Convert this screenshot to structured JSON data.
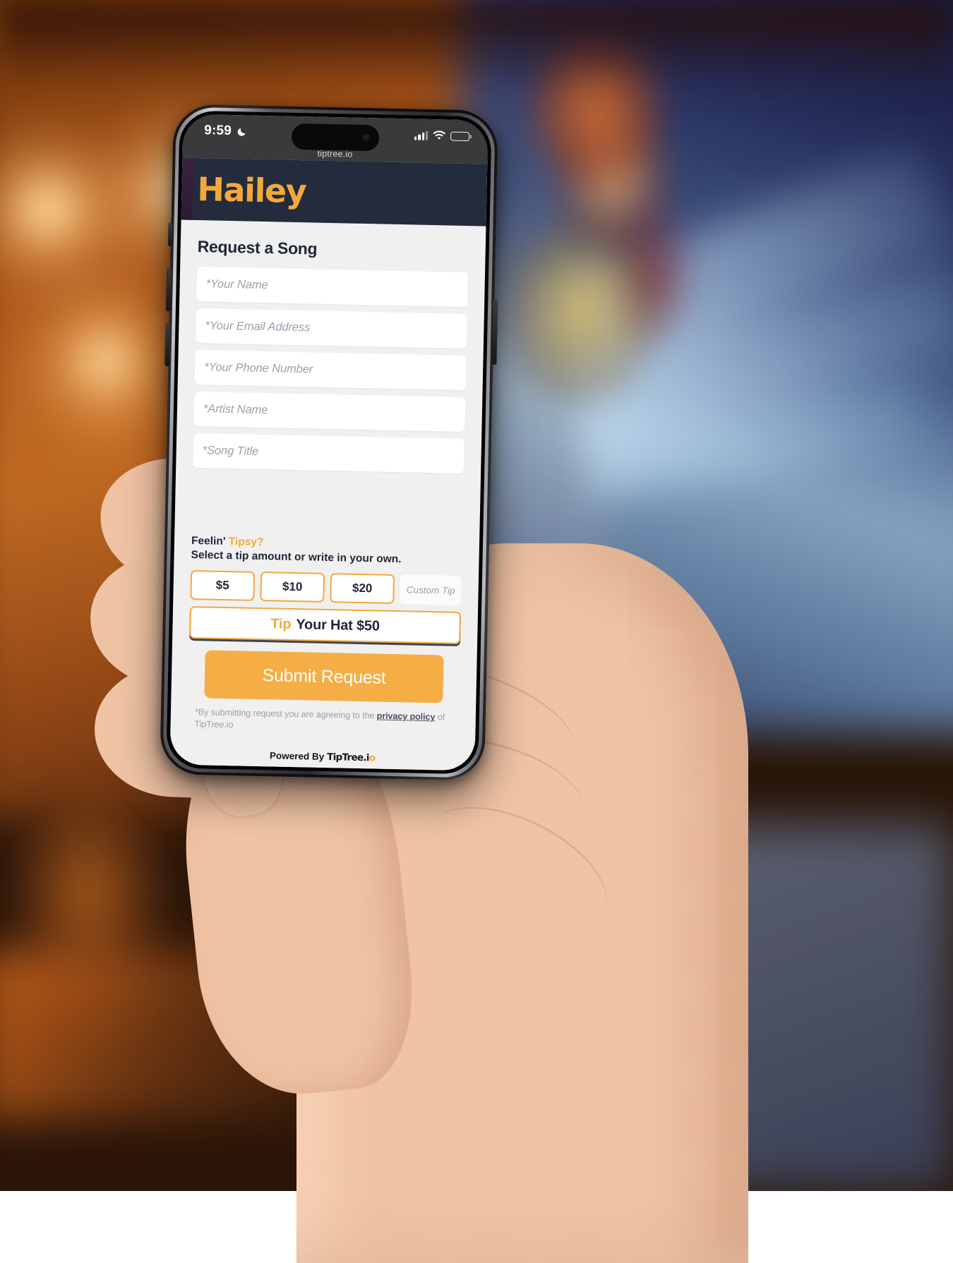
{
  "status_bar": {
    "time": "9:59",
    "moon_icon": "crescent-moon-icon",
    "signal_icon": "cellular-signal-icon",
    "wifi_icon": "wifi-icon",
    "battery_icon": "battery-icon"
  },
  "browser": {
    "url": "tiptree.io"
  },
  "header": {
    "brand": "Hailey"
  },
  "form": {
    "title": "Request a Song",
    "fields": [
      {
        "name": "your-name",
        "placeholder": "*Your Name"
      },
      {
        "name": "email-address",
        "placeholder": "*Your Email Address"
      },
      {
        "name": "phone-number",
        "placeholder": "*Your Phone Number"
      },
      {
        "name": "artist-name",
        "placeholder": "*Artist Name"
      },
      {
        "name": "song-title",
        "placeholder": "*Song Title"
      }
    ]
  },
  "tip": {
    "heading_plain": "Feelin'",
    "heading_accent": "Tipsy?",
    "subheading": "Select a tip amount or write in your own.",
    "amounts": [
      "$5",
      "$10",
      "$20"
    ],
    "custom_placeholder": "Custom Tip",
    "hat_accent": "Tip",
    "hat_label": "Your Hat $50"
  },
  "actions": {
    "submit": "Submit Request"
  },
  "disclaimer": {
    "before": "*By submitting request you are agreeing to the ",
    "link": "privacy policy",
    "after": " of TipTree.io"
  },
  "footer": {
    "powered_by": "Powered By",
    "brand_main": "TipTree.i",
    "brand_dot": "o"
  },
  "colors": {
    "accent": "#f2a93b",
    "header_bg": "#232b3c",
    "card_bg": "#f0f0f0",
    "submit_bg": "#f5ae46",
    "text_dark": "#1f2736",
    "placeholder": "#9aa0ab"
  }
}
